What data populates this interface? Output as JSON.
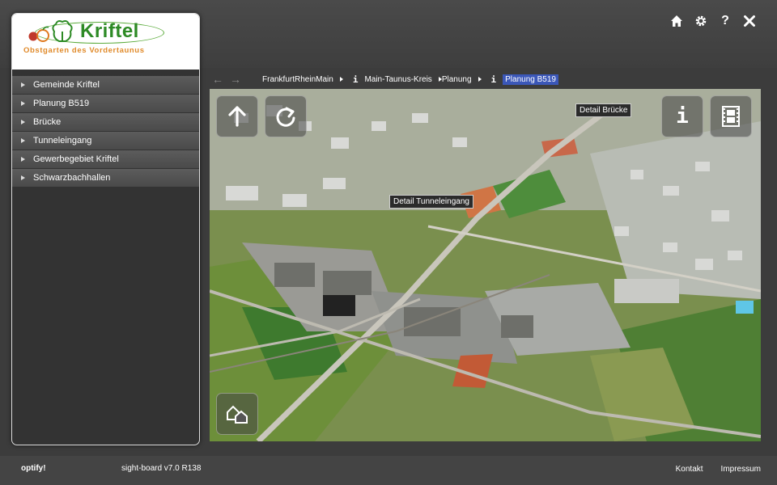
{
  "header": {
    "icons": [
      "home-icon",
      "gear-icon",
      "help-icon",
      "close-icon"
    ],
    "help_glyph": "?"
  },
  "logo": {
    "name": "Kriftel",
    "tagline": "Obstgarten des Vordertaunus",
    "colors": {
      "green": "#2d8a25",
      "orange": "#e08a2a"
    }
  },
  "sidebar": {
    "items": [
      {
        "label": "Gemeinde Kriftel"
      },
      {
        "label": "Planung B519"
      },
      {
        "label": "Brücke"
      },
      {
        "label": "Tunneleingang"
      },
      {
        "label": "Gewerbegebiet Kriftel"
      },
      {
        "label": "Schwarzbachhallen"
      }
    ]
  },
  "breadcrumb": {
    "back": "←",
    "forward": "→",
    "info_glyph": "i",
    "items": [
      "FrankfurtRheinMain",
      "Main-Taunus-Kreis",
      "Planung",
      "Planung B519"
    ],
    "active_color": "#3b57b8"
  },
  "map": {
    "labels": {
      "bruecke": "Detail Brücke",
      "tunnel": "Detail Tunneleingang"
    },
    "info_glyph": "i"
  },
  "footer": {
    "brand": "optify!",
    "version": "sight-board v7.0 R138",
    "links": [
      "Kontakt",
      "Impressum"
    ]
  }
}
